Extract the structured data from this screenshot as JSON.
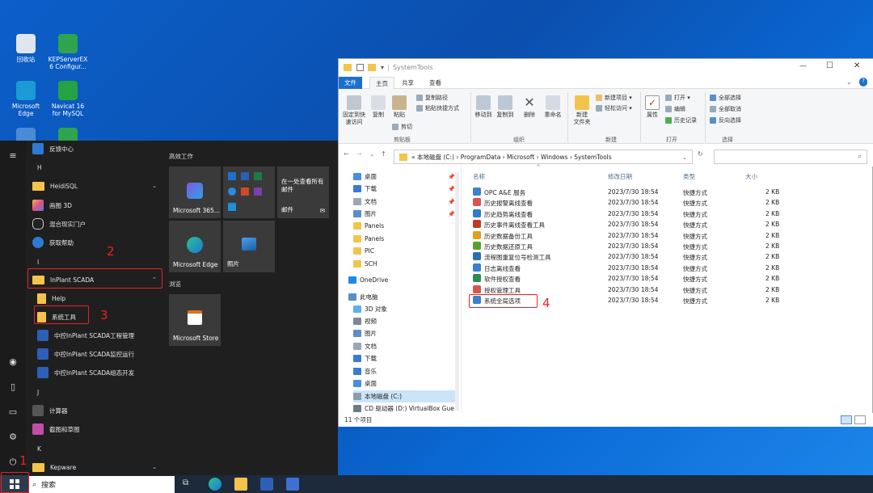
{
  "desktop": {
    "icons": [
      {
        "label": "回收站",
        "color": "#dfe6ef"
      },
      {
        "label": "KEPServerEX 6 Configur...",
        "color": "#2fa34d"
      },
      {
        "label": "Microsoft Edge",
        "color": "#1a9ad6"
      },
      {
        "label": "Navicat 16 for MySQL",
        "color": "#25a244"
      },
      {
        "label": "",
        "color": "#4a8bd6"
      },
      {
        "label": "",
        "color": "#2fa34d"
      }
    ]
  },
  "start_menu": {
    "items": {
      "feedback": "反馈中心",
      "h_header": "H",
      "heidisql": "HeidiSQL",
      "paint3d": "画图 3D",
      "mixed_reality": "混合现实门户",
      "get_help": "获取帮助",
      "i_header": "I",
      "inplant": "InPlant SCADA",
      "help": "Help",
      "system_tools": "系统工具",
      "proj_mgmt": "中控InPlant SCADA工程管理",
      "monitor": "中控InPlant SCADA监控运行",
      "config": "中控InPlant SCADA组态开发",
      "j_header": "J",
      "calculator": "计算器",
      "snip": "截图和草图",
      "k_header": "K",
      "kepware": "Kepware"
    },
    "sections": {
      "work": "高效工作",
      "browse": "浏览"
    },
    "tiles": {
      "m365": "Microsoft 365...",
      "mail_promo": "在一处查看所有邮件",
      "mail": "邮件",
      "edge": "Microsoft Edge",
      "photos": "照片",
      "store": "Microsoft Store"
    }
  },
  "annotations": [
    "1",
    "2",
    "3",
    "4"
  ],
  "taskbar": {
    "search_placeholder": "搜索"
  },
  "explorer": {
    "title": "SystemTools",
    "tabs": [
      "文件",
      "主页",
      "共享",
      "查看"
    ],
    "ribbon": {
      "pin": "固定到快\n速访问",
      "copy": "复制",
      "paste": "粘贴",
      "copy_path": "复制路径",
      "paste_shortcut": "粘贴快捷方式",
      "cut": "剪切",
      "group_clipboard": "剪贴板",
      "move_to": "移动到",
      "copy_to": "复制到",
      "delete": "删除",
      "rename": "重命名",
      "group_organize": "组织",
      "new_folder": "新建\n文件夹",
      "new_item": "新建项目 ▾",
      "easy_access": "轻松访问 ▾",
      "group_new": "新建",
      "properties": "属性",
      "open": "打开 ▾",
      "edit": "编辑",
      "history": "历史记录",
      "group_open": "打开",
      "select_all": "全部选择",
      "select_none": "全部取消",
      "invert": "反向选择",
      "group_select": "选择"
    },
    "address": "«  本地磁盘 (C:)  ›  ProgramData  ›  Microsoft  ›  Windows  ›  SystemTools",
    "nav": [
      {
        "label": "桌面",
        "color": "#4a90d9",
        "pin": true
      },
      {
        "label": "下载",
        "color": "#3a7bd5",
        "pin": true
      },
      {
        "label": "文档",
        "color": "#9aa7b5",
        "pin": true
      },
      {
        "label": "图片",
        "color": "#5b8fc7",
        "pin": true
      },
      {
        "label": "Panels",
        "color": "#f3c44b",
        "pin": false
      },
      {
        "label": "Panels",
        "color": "#f3c44b",
        "pin": false
      },
      {
        "label": "PIC",
        "color": "#f3c44b",
        "pin": false
      },
      {
        "label": "SCH",
        "color": "#f3c44b",
        "pin": false
      },
      {
        "label": "OneDrive",
        "color": "#1e88e5",
        "pin": false
      },
      {
        "label": "此电脑",
        "color": "#5b8fc7",
        "pin": false
      },
      {
        "label": "3D 对象",
        "color": "#5fb0e8",
        "pin": false
      },
      {
        "label": "视频",
        "color": "#7a8898",
        "pin": false
      },
      {
        "label": "图片",
        "color": "#5b8fc7",
        "pin": false
      },
      {
        "label": "文档",
        "color": "#9aa7b5",
        "pin": false
      },
      {
        "label": "下载",
        "color": "#3a7bd5",
        "pin": false
      },
      {
        "label": "音乐",
        "color": "#3a7bd5",
        "pin": false
      },
      {
        "label": "桌面",
        "color": "#4a90d9",
        "pin": false
      },
      {
        "label": "本地磁盘 (C:)",
        "color": "#8b9bb0",
        "pin": false
      },
      {
        "label": "CD 驱动器 (D:) VirtualBox Gue",
        "color": "#6d7a88",
        "pin": false
      }
    ],
    "columns": [
      "名称",
      "修改日期",
      "类型",
      "大小"
    ],
    "files": [
      {
        "name": "OPC A&E 服务",
        "date": "2023/7/30 18:54",
        "type": "快捷方式",
        "size": "2 KB",
        "color": "#3b7fd0"
      },
      {
        "name": "历史报警离线查看",
        "date": "2023/7/30 18:54",
        "type": "快捷方式",
        "size": "2 KB",
        "color": "#d9534f"
      },
      {
        "name": "历史趋势离线查看",
        "date": "2023/7/30 18:54",
        "type": "快捷方式",
        "size": "2 KB",
        "color": "#2e7bcf"
      },
      {
        "name": "历史事件离线查看工具",
        "date": "2023/7/30 18:54",
        "type": "快捷方式",
        "size": "2 KB",
        "color": "#c0392b"
      },
      {
        "name": "历史数据备份工具",
        "date": "2023/7/30 18:54",
        "type": "快捷方式",
        "size": "2 KB",
        "color": "#e0a020"
      },
      {
        "name": "历史数据还原工具",
        "date": "2023/7/30 18:54",
        "type": "快捷方式",
        "size": "2 KB",
        "color": "#5aa02c"
      },
      {
        "name": "流程图重复位号检测工具",
        "date": "2023/7/30 18:54",
        "type": "快捷方式",
        "size": "2 KB",
        "color": "#2a6fb0"
      },
      {
        "name": "日志离线查看",
        "date": "2023/7/30 18:54",
        "type": "快捷方式",
        "size": "2 KB",
        "color": "#3b7fd0"
      },
      {
        "name": "软件授权查看",
        "date": "2023/7/30 18:54",
        "type": "快捷方式",
        "size": "2 KB",
        "color": "#2e8b57"
      },
      {
        "name": "授权管理工具",
        "date": "2023/7/30 18:54",
        "type": "快捷方式",
        "size": "2 KB",
        "color": "#d9534f"
      },
      {
        "name": "系统全局选项",
        "date": "2023/7/30 18:54",
        "type": "快捷方式",
        "size": "2 KB",
        "color": "#3b7fd0"
      }
    ],
    "status": "11 个项目"
  }
}
